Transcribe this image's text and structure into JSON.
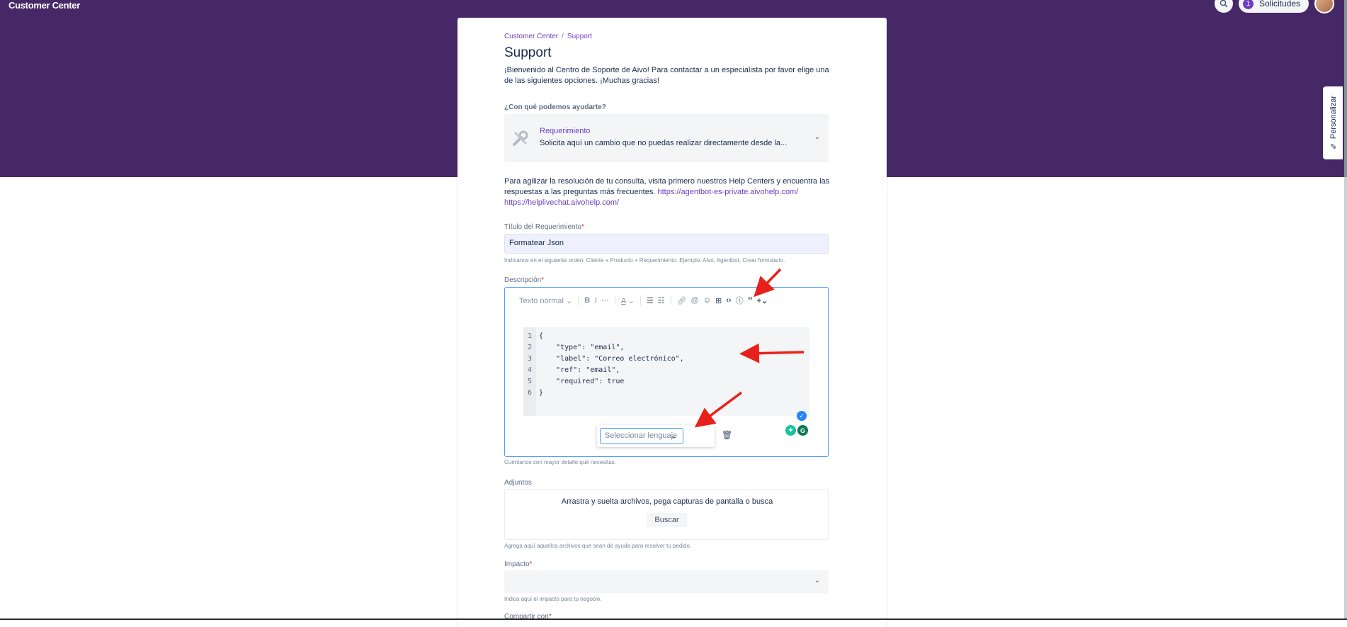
{
  "header": {
    "brand": "Customer Center",
    "requests_count": "1",
    "requests_label": "Solicitudes"
  },
  "sidebar_tab": {
    "label": "Personalizar"
  },
  "breadcrumb": {
    "root": "Customer Center",
    "separator": "/",
    "current": "Support"
  },
  "page": {
    "title": "Support",
    "welcome": "¡Bienvenido al Centro de Soporte de Aivo! Para contactar a un especialista por favor elige una de las siguientes opciones. ¡Muchas gracias!"
  },
  "request_type": {
    "question": "¿Con qué podemos ayudarte?",
    "name": "Requerimiento",
    "description": "Solicita aquí un cambio que no puedas realizar directamente desde la..."
  },
  "help": {
    "text": "Para agilizar la resolución de tu consulta, visita primero nuestros Help Centers y encuentra las respuestas a las preguntas más frecuentes.",
    "link1": "https://agentbot-es-private.aivohelp.com/",
    "link2": "https://helplivechat.aivohelp.com/"
  },
  "title_field": {
    "label": "Título del Requerimiento",
    "required_mark": "*",
    "value": "Formatear Json",
    "hint": "Indícanos en el siguiente orden: Cliente + Producto + Requerimiento. Ejemplo: Aivo, Agentbot, Crear formulario."
  },
  "description_field": {
    "label": "Descripción",
    "required_mark": "*",
    "hint": "Cuéntanos con mayor detalle qué necesitas.",
    "toolbar": {
      "text_style": "Texto normal",
      "bold": "B",
      "italic": "I",
      "more": "···",
      "color": "A",
      "icons": [
        "bullet-list-icon",
        "numbered-list-icon",
        "link-icon",
        "mention-icon",
        "emoji-icon",
        "table-icon",
        "code-icon",
        "info-icon",
        "quote-icon",
        "plus-icon"
      ]
    },
    "code_lines": [
      {
        "n": "1",
        "text": "{"
      },
      {
        "n": "2",
        "text": "    \"type\": \"email\","
      },
      {
        "n": "3",
        "text": "    \"label\": \"Correo electrónico\","
      },
      {
        "n": "4",
        "text": "    \"ref\": \"email\","
      },
      {
        "n": "5",
        "text": "    \"required\": true"
      },
      {
        "n": "6",
        "text": "}"
      }
    ],
    "language_placeholder": "Seleccionar lenguaje"
  },
  "attachments": {
    "label": "Adjuntos",
    "drop_text": "Arrastra y suelta archivos, pega capturas de pantalla o busca",
    "browse_label": "Buscar",
    "hint": "Agrega aquí aquellos archivos que sean de ayuda para resolver tu pedido."
  },
  "impact": {
    "label": "Impacto",
    "required_mark": "*",
    "hint": "Indica aquí el impacto para tu negocio."
  },
  "share": {
    "label": "Compartir con",
    "required_mark": "*"
  },
  "colors": {
    "header_bg": "#472866",
    "accent": "#6e3fc4",
    "annotation_arrow": "#e8201b"
  }
}
